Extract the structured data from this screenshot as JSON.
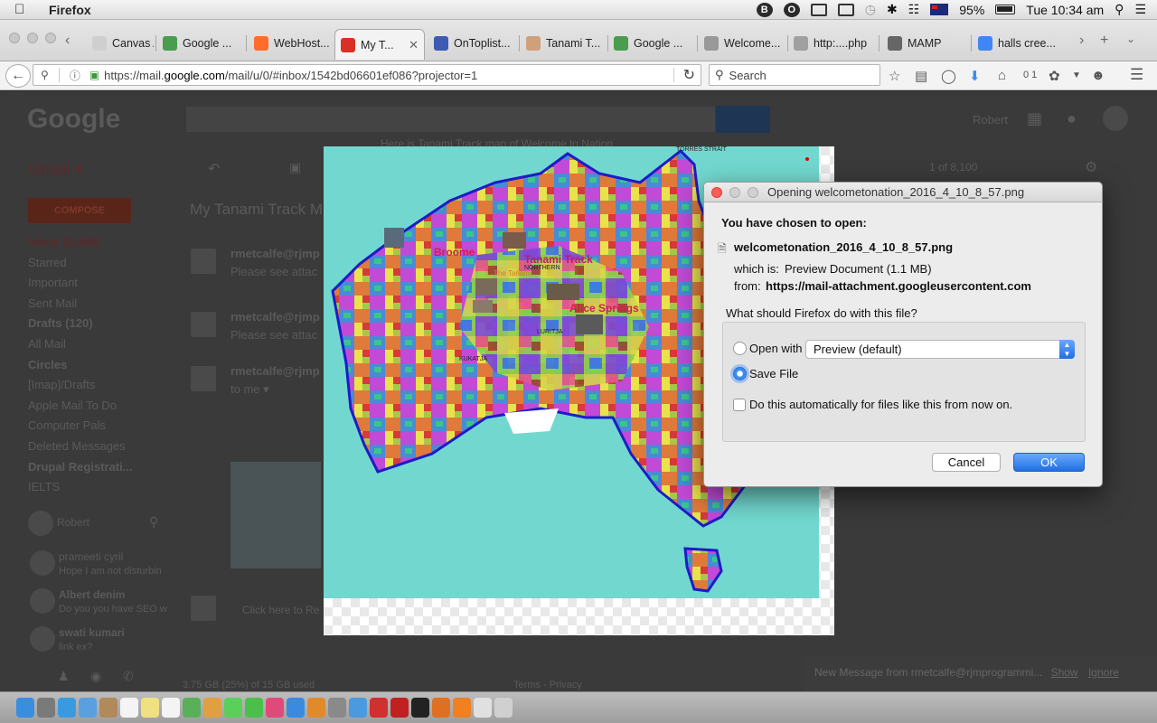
{
  "menubar": {
    "app_name": "Firefox",
    "battery": "95%",
    "clock": "Tue 10:34 am",
    "status_icons": [
      "b-icon",
      "o-icon",
      "film-icon",
      "airplay-icon",
      "time-machine-icon",
      "bluetooth-icon",
      "wifi-icon",
      "australia-flag-icon",
      "battery-icon",
      "spotlight-icon",
      "list-icon"
    ]
  },
  "tabs": [
    {
      "label": "Canvas A...",
      "icon": "blank-icon",
      "color": "#cfcfcf"
    },
    {
      "label": "Google ...",
      "icon": "google-maps-icon",
      "color": "#4a9c4e"
    },
    {
      "label": "WebHost...",
      "icon": "cpanel-icon",
      "color": "#ff6c2c"
    },
    {
      "label": "My T...",
      "icon": "gmail-icon",
      "color": "#d93025"
    },
    {
      "label": "OnToplist...",
      "icon": "ontoplist-icon",
      "color": "#3b5bb5"
    },
    {
      "label": "Tanami T...",
      "icon": "page-icon",
      "color": "#d0a07a"
    },
    {
      "label": "Google ...",
      "icon": "google-maps-icon",
      "color": "#4a9c4e"
    },
    {
      "label": "Welcome...",
      "icon": "thumbnail-icon",
      "color": "#999999"
    },
    {
      "label": "http:....php",
      "icon": "thumbnail-icon",
      "color": "#a0a0a0"
    },
    {
      "label": "MAMP",
      "icon": "globe-icon",
      "color": "#666666"
    },
    {
      "label": "halls cree...",
      "icon": "google-icon",
      "color": "#4285f4"
    }
  ],
  "tab_controls": {
    "scroll_right": "›",
    "new_tab": "+",
    "list_all": "⌄"
  },
  "navbar": {
    "url_host": "https://mail.",
    "url_domain": "google.com",
    "url_path": "/mail/u/0/#inbox/1542bd06601ef086?projector=1",
    "search_placeholder": "Search",
    "download_count": "0 1"
  },
  "gmail": {
    "logo": "Google",
    "account": "Robert",
    "app_label": "Gmail ▾",
    "compose": "COMPOSE",
    "pager": "1 of 8,100",
    "subject": "My Tanami Track M",
    "subject_line": "Here is Tanami Track map of Welcome to Nation",
    "sidebar": [
      {
        "label": "Inbox (2,958)",
        "bold": true
      },
      {
        "label": "Starred",
        "bold": false
      },
      {
        "label": "Important",
        "bold": false
      },
      {
        "label": "Sent Mail",
        "bold": false
      },
      {
        "label": "Drafts (120)",
        "bold": true
      },
      {
        "label": "All Mail",
        "bold": false
      },
      {
        "label": "Circles",
        "bold": true
      },
      {
        "label": "[Imap]/Drafts",
        "bold": false
      },
      {
        "label": "Apple Mail To Do",
        "bold": false
      },
      {
        "label": "Computer Pals",
        "bold": false
      },
      {
        "label": "Deleted Messages",
        "bold": false
      },
      {
        "label": "Drupal Registrati...",
        "bold": true
      },
      {
        "label": "IELTS",
        "bold": false
      }
    ],
    "messages": [
      {
        "from": "rmetcalfe@rjmp",
        "snippet": "Please see attac"
      },
      {
        "from": "rmetcalfe@rjmp",
        "snippet": "Please see attac"
      },
      {
        "from": "rmetcalfe@rjmp",
        "snippet": "to me ▾"
      }
    ],
    "chat_user": "Robert",
    "chats": [
      {
        "name": "prameeti cyril",
        "snippet": "Hope I am not disturbin"
      },
      {
        "name": "Albert denim",
        "snippet": "Do you you have SEO w"
      },
      {
        "name": "swati kumari",
        "snippet": "link ex?"
      }
    ],
    "reply_placeholder": "Click here to Re",
    "storage": "3.75 GB (25%) of 15 GB used",
    "terms": "Terms - Privacy",
    "notification": {
      "text": "New Message from rmetcalfe@rjmprogrammi...",
      "show": "Show",
      "ignore": "Ignore"
    }
  },
  "map": {
    "labels": [
      "Broome",
      "Tanami Track",
      "Alice Springs"
    ],
    "small_labels": [
      "TORRES STRAIT",
      "NORTHERN",
      "The Tanami",
      "LURITJA",
      "KUKATJA"
    ],
    "ocean_color": "#72d8cf",
    "outline_color": "#1c1cc8"
  },
  "dialog": {
    "title": "Opening welcometonation_2016_4_10_8_57.png",
    "chosen_heading": "You have chosen to open:",
    "filename": "welcometonation_2016_4_10_8_57.png",
    "which_is_label": "which is:",
    "which_is_value": "Preview Document (1.1 MB)",
    "from_label": "from:",
    "from_value": "https://mail-attachment.googleusercontent.com",
    "question": "What should Firefox do with this file?",
    "open_with_label": "Open with",
    "open_with_value": "Preview (default)",
    "save_label": "Save File",
    "auto_label": "Do this automatically for files like this from now on.",
    "selected": "save",
    "auto_checked": false,
    "cancel": "Cancel",
    "ok": "OK"
  },
  "dock_icons": [
    "finder-icon",
    "launchpad-icon",
    "safari-icon",
    "mail-icon",
    "contacts-icon",
    "calendar-icon",
    "notes-icon",
    "reminders-icon",
    "maps-icon",
    "photos-icon",
    "messages-icon",
    "facetime-icon",
    "itunes-icon",
    "app-store-icon",
    "ibooks-icon",
    "system-preferences-icon",
    "chrome-icon",
    "opera-icon",
    "filezilla-icon",
    "terminal-icon",
    "firefox-icon",
    "vlc-icon",
    "help-icon",
    "trash-icon"
  ]
}
